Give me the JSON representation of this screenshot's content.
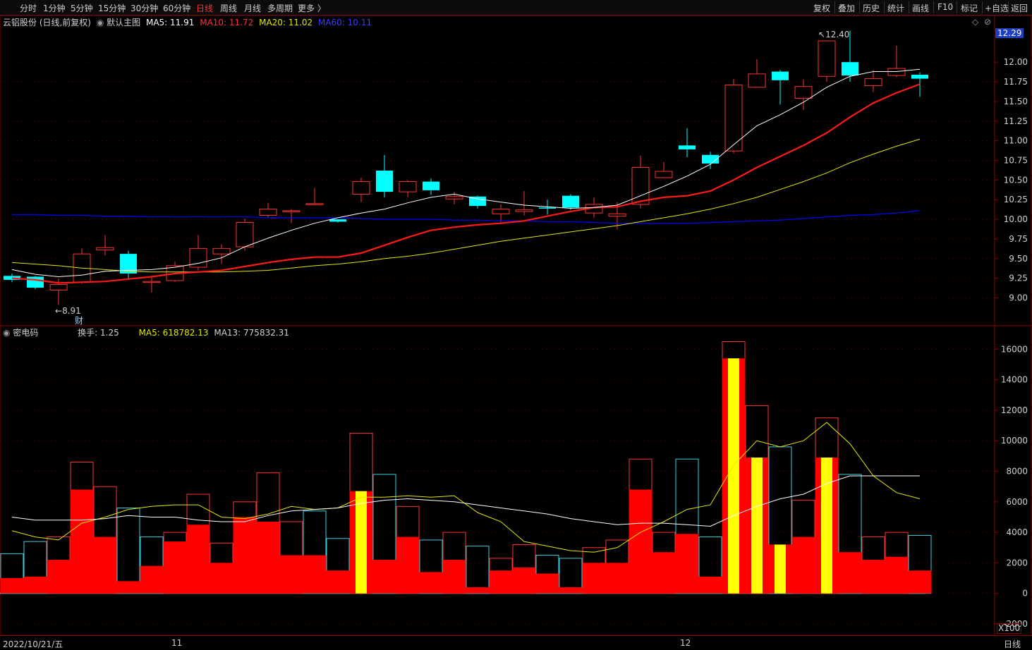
{
  "toolbar": {
    "tabs": [
      "分时",
      "1分钟",
      "5分钟",
      "15分钟",
      "30分钟",
      "60分钟",
      "日线",
      "周线",
      "月线",
      "多周期",
      "更多 〉"
    ],
    "active_tab": "日线",
    "right_buttons": [
      "复权",
      "叠加",
      "历史",
      "统计",
      "画线",
      "F10",
      "标记",
      "+自选",
      "返回"
    ]
  },
  "main_chart": {
    "stock_title": "云铝股份 (日线,前复权)",
    "chart_label": "默认主图",
    "ma5": "MA5: 11.91",
    "ma10": "MA10: 11.72",
    "ma20": "MA20: 11.02",
    "ma60": "MA60: 10.11",
    "high_mark": "12.40",
    "low_mark": "8.91",
    "finance_mark": "财",
    "current_price": "12.29",
    "colors": {
      "up": "#ff3232",
      "down": "#00ffff",
      "ma5": "#ffffff",
      "ma10": "#ff1a1a",
      "ma20": "#e6e600",
      "ma60": "#0000ff"
    }
  },
  "sub_chart": {
    "indicator_name": "密电码",
    "turnover": "换手: 1.25",
    "ma5": "MA5: 618782.13",
    "ma13": "MA13: 775832.31",
    "unit": "X100"
  },
  "bottom": {
    "date": "2022/10/21/五",
    "month_11": "11",
    "month_12": "12",
    "period": "日线"
  },
  "chart_data": [
    {
      "type": "candlestick",
      "price_axis": [
        9.0,
        9.25,
        9.5,
        9.75,
        10.0,
        10.25,
        10.5,
        10.75,
        11.0,
        11.25,
        11.5,
        11.75,
        12.0
      ],
      "ylim": [
        8.7,
        12.45
      ],
      "candles": [
        {
          "o": 9.28,
          "c": 9.23,
          "h": 9.31,
          "l": 9.2
        },
        {
          "o": 9.27,
          "c": 9.13,
          "h": 9.28,
          "l": 9.11
        },
        {
          "o": 9.1,
          "c": 9.17,
          "h": 9.25,
          "l": 8.91
        },
        {
          "o": 9.2,
          "c": 9.56,
          "h": 9.63,
          "l": 9.18
        },
        {
          "o": 9.61,
          "c": 9.64,
          "h": 9.8,
          "l": 9.54
        },
        {
          "o": 9.56,
          "c": 9.31,
          "h": 9.6,
          "l": 9.23
        },
        {
          "o": 9.21,
          "c": 9.21,
          "h": 9.28,
          "l": 9.07
        },
        {
          "o": 9.22,
          "c": 9.41,
          "h": 9.46,
          "l": 9.2
        },
        {
          "o": 9.39,
          "c": 9.63,
          "h": 9.8,
          "l": 9.35
        },
        {
          "o": 9.56,
          "c": 9.63,
          "h": 9.68,
          "l": 9.43
        },
        {
          "o": 9.65,
          "c": 9.96,
          "h": 10.01,
          "l": 9.6
        },
        {
          "o": 10.05,
          "c": 10.13,
          "h": 10.21,
          "l": 10.02
        },
        {
          "o": 10.11,
          "c": 10.11,
          "h": 10.13,
          "l": 9.95
        },
        {
          "o": 10.2,
          "c": 10.2,
          "h": 10.4,
          "l": 10.19
        },
        {
          "o": 10.0,
          "c": 9.97,
          "h": 10.0,
          "l": 9.96
        },
        {
          "o": 10.32,
          "c": 10.48,
          "h": 10.53,
          "l": 10.22
        },
        {
          "o": 10.62,
          "c": 10.35,
          "h": 10.82,
          "l": 10.28
        },
        {
          "o": 10.35,
          "c": 10.48,
          "h": 10.5,
          "l": 10.28
        },
        {
          "o": 10.48,
          "c": 10.37,
          "h": 10.52,
          "l": 10.31
        },
        {
          "o": 10.26,
          "c": 10.29,
          "h": 10.35,
          "l": 10.19
        },
        {
          "o": 10.29,
          "c": 10.17,
          "h": 10.3,
          "l": 10.14
        },
        {
          "o": 10.07,
          "c": 10.13,
          "h": 10.19,
          "l": 9.94
        },
        {
          "o": 10.1,
          "c": 10.12,
          "h": 10.36,
          "l": 10.05
        },
        {
          "o": 10.15,
          "c": 10.14,
          "h": 10.25,
          "l": 10.06
        },
        {
          "o": 10.3,
          "c": 10.15,
          "h": 10.32,
          "l": 10.12
        },
        {
          "o": 10.08,
          "c": 10.19,
          "h": 10.28,
          "l": 10.02
        },
        {
          "o": 10.04,
          "c": 10.07,
          "h": 10.22,
          "l": 9.87
        },
        {
          "o": 10.19,
          "c": 10.66,
          "h": 10.81,
          "l": 10.14
        },
        {
          "o": 10.53,
          "c": 10.61,
          "h": 10.73,
          "l": 10.53
        },
        {
          "o": 10.94,
          "c": 10.89,
          "h": 11.16,
          "l": 10.79
        },
        {
          "o": 10.82,
          "c": 10.71,
          "h": 10.86,
          "l": 10.64
        },
        {
          "o": 10.87,
          "c": 11.71,
          "h": 11.79,
          "l": 10.84
        },
        {
          "o": 11.68,
          "c": 11.85,
          "h": 12.04,
          "l": 11.68
        },
        {
          "o": 11.88,
          "c": 11.77,
          "h": 11.9,
          "l": 11.46
        },
        {
          "o": 11.54,
          "c": 11.69,
          "h": 11.78,
          "l": 11.39
        },
        {
          "o": 11.82,
          "c": 12.27,
          "h": 12.27,
          "l": 11.75
        },
        {
          "o": 12.0,
          "c": 11.83,
          "h": 12.4,
          "l": 11.75
        },
        {
          "o": 11.7,
          "c": 11.79,
          "h": 11.9,
          "l": 11.62
        },
        {
          "o": 11.83,
          "c": 11.92,
          "h": 12.21,
          "l": 11.81
        },
        {
          "o": 11.84,
          "c": 11.79,
          "h": 11.87,
          "l": 11.56
        }
      ],
      "ma5": [
        9.36,
        9.3,
        9.27,
        9.29,
        9.34,
        9.35,
        9.36,
        9.39,
        9.44,
        9.51,
        9.65,
        9.76,
        9.86,
        9.95,
        10.02,
        10.08,
        10.13,
        10.21,
        10.28,
        10.32,
        10.26,
        10.22,
        10.18,
        10.16,
        10.14,
        10.15,
        10.18,
        10.3,
        10.42,
        10.55,
        10.7,
        10.95,
        11.19,
        11.33,
        11.49,
        11.68,
        11.82,
        11.88,
        11.88,
        11.91
      ],
      "ma10": [
        9.25,
        9.23,
        9.19,
        9.2,
        9.21,
        9.24,
        9.27,
        9.31,
        9.33,
        9.35,
        9.4,
        9.45,
        9.49,
        9.52,
        9.52,
        9.57,
        9.67,
        9.77,
        9.86,
        9.9,
        9.93,
        9.95,
        9.98,
        10.04,
        10.1,
        10.15,
        10.16,
        10.23,
        10.28,
        10.3,
        10.36,
        10.5,
        10.66,
        10.8,
        10.94,
        11.1,
        11.3,
        11.48,
        11.61,
        11.72
      ],
      "ma20": [
        9.45,
        9.43,
        9.41,
        9.38,
        9.36,
        9.34,
        9.33,
        9.33,
        9.33,
        9.33,
        9.34,
        9.35,
        9.38,
        9.41,
        9.43,
        9.46,
        9.5,
        9.53,
        9.57,
        9.62,
        9.67,
        9.72,
        9.76,
        9.8,
        9.84,
        9.88,
        9.92,
        9.97,
        10.02,
        10.07,
        10.13,
        10.2,
        10.28,
        10.38,
        10.48,
        10.59,
        10.72,
        10.83,
        10.93,
        11.02
      ],
      "ma60": [
        10.06,
        10.06,
        10.05,
        10.05,
        10.04,
        10.04,
        10.03,
        10.03,
        10.03,
        10.03,
        10.03,
        10.02,
        10.02,
        10.02,
        10.02,
        10.01,
        10.0,
        10.0,
        10.0,
        9.99,
        9.99,
        9.98,
        9.98,
        9.97,
        9.97,
        9.96,
        9.95,
        9.95,
        9.95,
        9.95,
        9.96,
        9.97,
        9.98,
        9.99,
        10.01,
        10.03,
        10.05,
        10.06,
        10.08,
        10.11
      ]
    },
    {
      "type": "bar",
      "y_axis": [
        -2000,
        0,
        2000,
        4000,
        6000,
        8000,
        10000,
        12000,
        14000,
        16000
      ],
      "ylim": [
        -2600,
        16800
      ],
      "unit": "X100",
      "bars": [
        {
          "t": 2600,
          "f": 1000,
          "c": "c"
        },
        {
          "t": 3400,
          "f": 1100,
          "c": "c"
        },
        {
          "t": 3700,
          "f": 2200,
          "c": "r"
        },
        {
          "t": 8600,
          "f": 6800,
          "c": "r"
        },
        {
          "t": 7000,
          "f": 3700,
          "c": "r"
        },
        {
          "t": 5600,
          "f": 800,
          "c": "c"
        },
        {
          "t": 3700,
          "f": 1800,
          "c": "c"
        },
        {
          "t": 4000,
          "f": 3400,
          "c": "r"
        },
        {
          "t": 6500,
          "f": 4500,
          "c": "r"
        },
        {
          "t": 3300,
          "f": 2000,
          "c": "r"
        },
        {
          "t": 6000,
          "f": 5000,
          "c": "r"
        },
        {
          "t": 7900,
          "f": 4700,
          "c": "r"
        },
        {
          "t": 4700,
          "f": 2500,
          "c": "r"
        },
        {
          "t": 5400,
          "f": 2500,
          "c": "c"
        },
        {
          "t": 3600,
          "f": 1500,
          "c": "c"
        },
        {
          "t": 10500,
          "f": 6700,
          "c": "r",
          "y": true
        },
        {
          "t": 7800,
          "f": 2200,
          "c": "c"
        },
        {
          "t": 5700,
          "f": 3700,
          "c": "r"
        },
        {
          "t": 3500,
          "f": 1400,
          "c": "c"
        },
        {
          "t": 4000,
          "f": 2200,
          "c": "r"
        },
        {
          "t": 3100,
          "f": 400,
          "c": "c"
        },
        {
          "t": 2300,
          "f": 1500,
          "c": "r"
        },
        {
          "t": 3200,
          "f": 1700,
          "c": "r"
        },
        {
          "t": 2500,
          "f": 1300,
          "c": "c"
        },
        {
          "t": 2300,
          "f": 400,
          "c": "c"
        },
        {
          "t": 3000,
          "f": 2000,
          "c": "r"
        },
        {
          "t": 3500,
          "f": 2000,
          "c": "r"
        },
        {
          "t": 8800,
          "f": 6800,
          "c": "r"
        },
        {
          "t": 4000,
          "f": 2700,
          "c": "r"
        },
        {
          "t": 8800,
          "f": 3900,
          "c": "c"
        },
        {
          "t": 3700,
          "f": 1100,
          "c": "c"
        },
        {
          "t": 16500,
          "f": 15400,
          "c": "r",
          "y": true
        },
        {
          "t": 12300,
          "f": 8900,
          "c": "r",
          "y": true
        },
        {
          "t": 9600,
          "f": 3200,
          "c": "c",
          "y": true
        },
        {
          "t": 6100,
          "f": 3700,
          "c": "r"
        },
        {
          "t": 11500,
          "f": 8900,
          "c": "r",
          "y": true
        },
        {
          "t": 7800,
          "f": 2700,
          "c": "c"
        },
        {
          "t": 3700,
          "f": 2200,
          "c": "r"
        },
        {
          "t": 4000,
          "f": 2400,
          "c": "r"
        },
        {
          "t": 3800,
          "f": 1500,
          "c": "c"
        }
      ],
      "ma5": [
        4100,
        3700,
        3500,
        4600,
        5000,
        5500,
        5700,
        5800,
        5800,
        5000,
        4900,
        5200,
        5700,
        5500,
        5600,
        6300,
        6300,
        6400,
        6300,
        6400,
        5300,
        4700,
        3400,
        3100,
        2800,
        2700,
        3000,
        4000,
        4700,
        5500,
        5800,
        8400,
        10000,
        9600,
        10000,
        11200,
        9800,
        7700,
        6600,
        6200
      ],
      "ma13": [
        5000,
        4800,
        4800,
        4800,
        4900,
        5100,
        5000,
        5000,
        4800,
        4700,
        4700,
        5100,
        5400,
        5500,
        5600,
        5900,
        6100,
        6200,
        6100,
        6000,
        5800,
        5600,
        5400,
        5200,
        4900,
        4700,
        4500,
        4600,
        4600,
        4500,
        4400,
        5100,
        5700,
        6200,
        6500,
        7200,
        7700,
        7700,
        7700,
        7700
      ]
    }
  ]
}
